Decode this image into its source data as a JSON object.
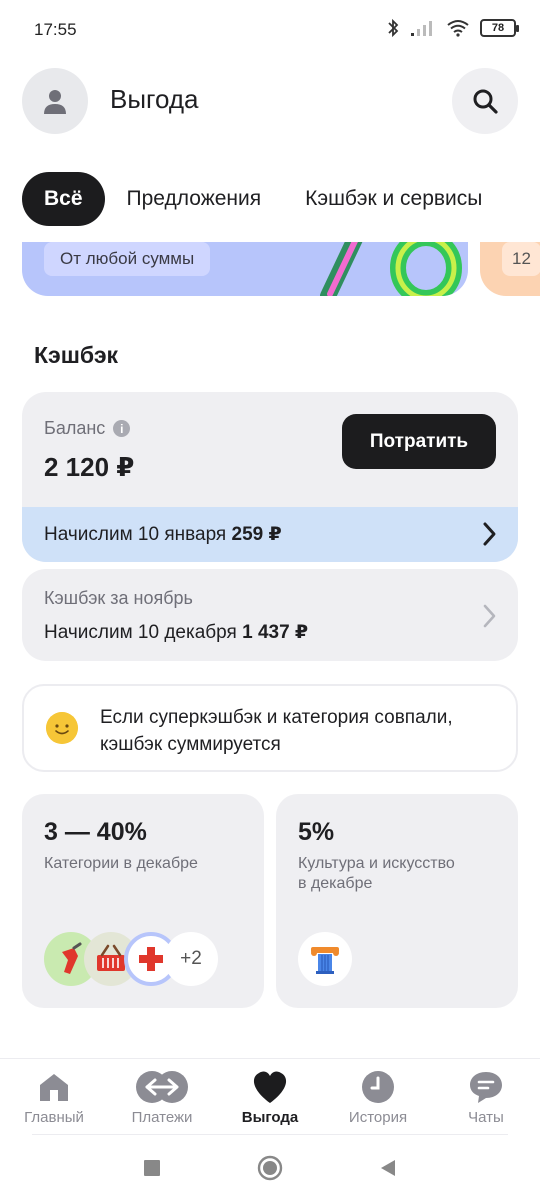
{
  "status_bar": {
    "time": "17:55",
    "battery": "78"
  },
  "header": {
    "title": "Выгода"
  },
  "tabs": [
    {
      "label": "Всё",
      "active": true
    },
    {
      "label": "Предложения",
      "active": false
    },
    {
      "label": "Кэшбэк и сервисы",
      "active": false
    }
  ],
  "promo": {
    "chip": "От любой суммы",
    "chip2": "12"
  },
  "cashback": {
    "section_title": "Кэшбэк",
    "balance_label": "Баланс",
    "balance_value": "2 120 ₽",
    "spend_button": "Потратить",
    "accrual_text": "Начислим 10 января",
    "accrual_amount": "259 ₽",
    "november_title": "Кэшбэк за ноябрь",
    "november_text": "Начислим 10 декабря",
    "november_amount": "1 437 ₽"
  },
  "tip": {
    "line1": "Если суперкэшбэк и категория совпали,",
    "line2": "кэшбэк суммируется"
  },
  "categories": [
    {
      "value": "3 — 40%",
      "desc": "Категории в декабре",
      "more": "+2"
    },
    {
      "value": "5%",
      "desc_line1": "Культура и искусство",
      "desc_line2": "в декабре"
    }
  ],
  "bottom_nav": [
    {
      "label": "Главный",
      "icon": "home-icon",
      "active": false
    },
    {
      "label": "Платежи",
      "icon": "payments-icon",
      "active": false
    },
    {
      "label": "Выгода",
      "icon": "heart-icon",
      "active": true
    },
    {
      "label": "История",
      "icon": "clock-icon",
      "active": false
    },
    {
      "label": "Чаты",
      "icon": "chat-icon",
      "active": false
    }
  ],
  "colors": {
    "accent_dark": "#1c1c1e",
    "card_bg": "#efeff2",
    "accrual_bg": "#cfe1f8",
    "promo_bg": "#b7c5fb"
  }
}
